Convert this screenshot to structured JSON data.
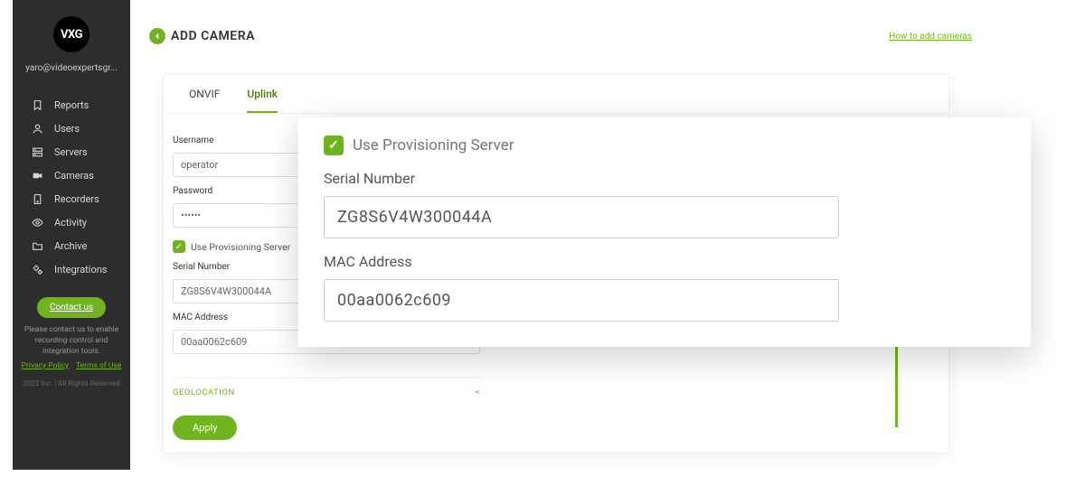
{
  "brand": {
    "logo_text": "VXG"
  },
  "user": {
    "email": "yaro@videoexpertsgr..."
  },
  "sidebar": {
    "items": [
      {
        "label": "Reports",
        "icon": "bookmark-icon"
      },
      {
        "label": "Users",
        "icon": "user-icon"
      },
      {
        "label": "Servers",
        "icon": "servers-icon"
      },
      {
        "label": "Cameras",
        "icon": "camera-icon"
      },
      {
        "label": "Recorders",
        "icon": "recorder-icon"
      },
      {
        "label": "Activity",
        "icon": "eye-icon"
      },
      {
        "label": "Archive",
        "icon": "folder-icon"
      },
      {
        "label": "Integrations",
        "icon": "gear-icon"
      }
    ],
    "contact_label": "Contact us",
    "footer_text": "Please contact us to enable recording control and integration tools.",
    "privacy_label": "Privacy Policy",
    "terms_label": "Terms of Use",
    "copyright": "2022 Inc. | All Rights Reserved"
  },
  "header": {
    "title": "ADD CAMERA",
    "howto_link": "How to add cameras"
  },
  "tabs": [
    {
      "label": "ONVIF",
      "active": false
    },
    {
      "label": "Uplink",
      "active": true
    }
  ],
  "form": {
    "username_label": "Username",
    "username_value": "operator",
    "password_label": "Password",
    "password_value": "••••••",
    "provisioning_label": "Use Provisioning Server",
    "provisioning_checked": true,
    "serial_label": "Serial Number",
    "serial_value": "ZG8S6V4W300044A",
    "mac_label": "MAC Address",
    "mac_value": "00aa0062c609",
    "geolocation_label": "GEOLOCATION",
    "geolocation_toggle": "<",
    "apply_label": "Apply"
  },
  "callout": {
    "provisioning_label": "Use Provisioning Server",
    "serial_label": "Serial Number",
    "serial_value": "ZG8S6V4W300044A",
    "mac_label": "MAC Address",
    "mac_value": "00aa0062c609"
  }
}
